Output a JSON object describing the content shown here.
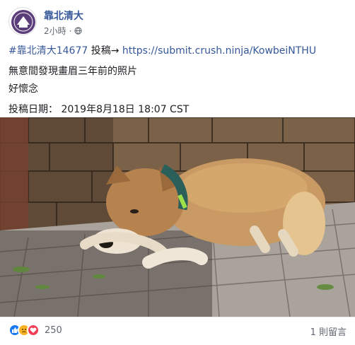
{
  "post": {
    "page_name": "靠北清大",
    "time": "2小時",
    "hashtag": "#靠北清大14677",
    "submit_label": "投稿→",
    "link": "https://submit.crush.ninja/KowbeiNTHU",
    "caption_line1": "無意間發現畫眉三年前的照片",
    "caption_line2": "好懷念",
    "posted_label": "投稿日期：",
    "posted_date": "2019年8月18日 18:07 CST"
  },
  "footer": {
    "reaction_count": "250",
    "comments": "1 則留言"
  },
  "colors": {
    "link": "#365899",
    "like": "#1877f2",
    "heart": "#f33e58",
    "sad": "#f7b125"
  },
  "icons": {
    "privacy": "globe-icon",
    "reactions": [
      "like-icon",
      "sad-icon",
      "love-icon"
    ]
  }
}
